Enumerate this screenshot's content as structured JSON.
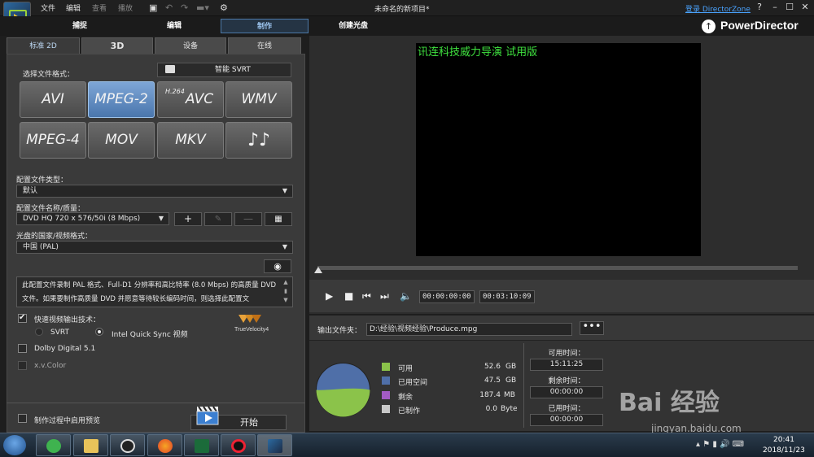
{
  "window": {
    "menu": [
      "文件",
      "编辑",
      "查看",
      "播放"
    ],
    "title": "未命名的新项目*",
    "login_link": "登录 DirectorZone",
    "help": "?",
    "minimize": "–",
    "maximize": "☐",
    "close": "✕"
  },
  "modes": [
    "捕捉",
    "编辑",
    "制作",
    "创建光盘"
  ],
  "brand": "PowerDirector",
  "sub_tabs": [
    "标准 2D",
    "3D",
    "设备",
    "在线"
  ],
  "left": {
    "choose_format_label": "选择文件格式：",
    "svrt_label": "智能 SVRT",
    "formats": [
      {
        "label": "AVI",
        "prefix": ""
      },
      {
        "label": "MPEG-2",
        "prefix": ""
      },
      {
        "label": "AVC",
        "prefix": "H.264"
      },
      {
        "label": "WMV",
        "prefix": ""
      },
      {
        "label": "MPEG-4",
        "prefix": ""
      },
      {
        "label": "MOV",
        "prefix": ""
      },
      {
        "label": "MKV",
        "prefix": ""
      },
      {
        "label": "♪♪",
        "prefix": ""
      }
    ],
    "profile_type_label": "配置文件类型：",
    "profile_type_value": "默认",
    "profile_name_label": "配置文件名称/质量：",
    "profile_name_value": "DVD HQ 720 x 576/50i (8 Mbps)",
    "add_btn": "+",
    "remove_btn": "—",
    "region_label": "光盘的国家/视频格式：",
    "region_value": "中国 (PAL)",
    "description": "此配置文件录制 PAL 格式、Full-D1 分辨率和高比特率 (8.0 Mbps) 的高质量 DVD 文件。如果要制作高质量 DVD 并愿意等待较长编码时间，则选择此配置文",
    "fast_render_label": "快速视频输出技术：",
    "svrt_radio": "SVRT",
    "intel_radio": "Intel Quick Sync 视频",
    "trueveloc": "TrueVelocity4",
    "dolby": "Dolby Digital 5.1",
    "xvcolor": "x.v.Color",
    "preview_label": "制作过程中启用预览",
    "start_label": "开始"
  },
  "preview": {
    "watermark": "讯连科技威力导演 试用版",
    "position_timecode": "00:00:00:00",
    "duration_timecode": "00:03:10:09",
    "scrub_position": 0
  },
  "output": {
    "folder_label": "输出文件夹：",
    "path": "D:\\经验\\视频经验\\Produce.mpg",
    "browse": "•••",
    "legend": [
      {
        "label": "可用",
        "value": "52.6",
        "unit": "GB",
        "color": "#8bc34a"
      },
      {
        "label": "已用空间",
        "value": "47.5",
        "unit": "GB",
        "color": "#4f6fa8"
      },
      {
        "label": "剩余",
        "value": "187.4",
        "unit": "MB",
        "color": "#a25bc4"
      },
      {
        "label": "已制作",
        "value": "0.0",
        "unit": "Byte",
        "color": "#c8c8c8"
      }
    ],
    "available_time_label": "可用时间：",
    "available_time": "15:11:25",
    "remaining_time_label": "剩余时间：",
    "remaining_time": "00:00:00",
    "elapsed_time_label": "已用时间：",
    "elapsed_time": "00:00:00"
  },
  "watermark_overlay": {
    "logo": "Bai 经验",
    "url": "jingyan.baidu.com"
  },
  "taskbar": {
    "time": "20:41",
    "date": "2018/11/23"
  }
}
